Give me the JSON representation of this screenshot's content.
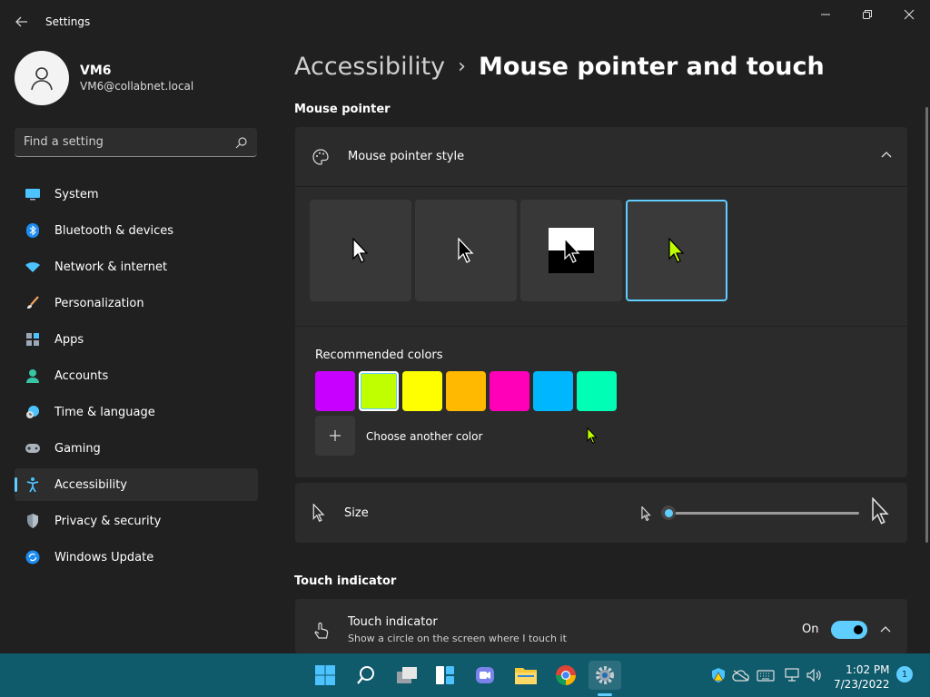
{
  "window": {
    "title": "Settings"
  },
  "profile": {
    "name": "VM6",
    "email": "VM6@collabnet.local"
  },
  "search": {
    "placeholder": "Find a setting"
  },
  "sidebar": {
    "items": [
      {
        "label": "System",
        "icon": "monitor-icon"
      },
      {
        "label": "Bluetooth & devices",
        "icon": "bluetooth-icon"
      },
      {
        "label": "Network & internet",
        "icon": "wifi-icon"
      },
      {
        "label": "Personalization",
        "icon": "brush-icon"
      },
      {
        "label": "Apps",
        "icon": "apps-icon"
      },
      {
        "label": "Accounts",
        "icon": "person-icon"
      },
      {
        "label": "Time & language",
        "icon": "clock-globe-icon"
      },
      {
        "label": "Gaming",
        "icon": "gamepad-icon"
      },
      {
        "label": "Accessibility",
        "icon": "accessibility-icon"
      },
      {
        "label": "Privacy & security",
        "icon": "shield-icon"
      },
      {
        "label": "Windows Update",
        "icon": "sync-icon"
      }
    ],
    "active_index": 8
  },
  "breadcrumb": {
    "parent": "Accessibility",
    "separator": "›",
    "current": "Mouse pointer and touch"
  },
  "mouse_pointer": {
    "section_title": "Mouse pointer",
    "style_label": "Mouse pointer style",
    "styles": [
      "white",
      "black",
      "inverted",
      "custom"
    ],
    "selected_style": 3,
    "recommended_label": "Recommended colors",
    "colors": [
      "#c800ff",
      "#bfff00",
      "#ffff00",
      "#ffb900",
      "#ff00b8",
      "#00b7ff",
      "#00ffb4"
    ],
    "selected_color": 1,
    "choose_label": "Choose another color",
    "size_label": "Size",
    "size_value": 0
  },
  "touch": {
    "section_title": "Touch indicator",
    "label": "Touch indicator",
    "description": "Show a circle on the screen where I touch it",
    "state": "On"
  },
  "taskbar": {
    "time": "1:02 PM",
    "date": "7/23/2022",
    "notifications": "1"
  },
  "colors": {
    "accent": "#60cdff",
    "taskbar": "#0f5a6b"
  }
}
